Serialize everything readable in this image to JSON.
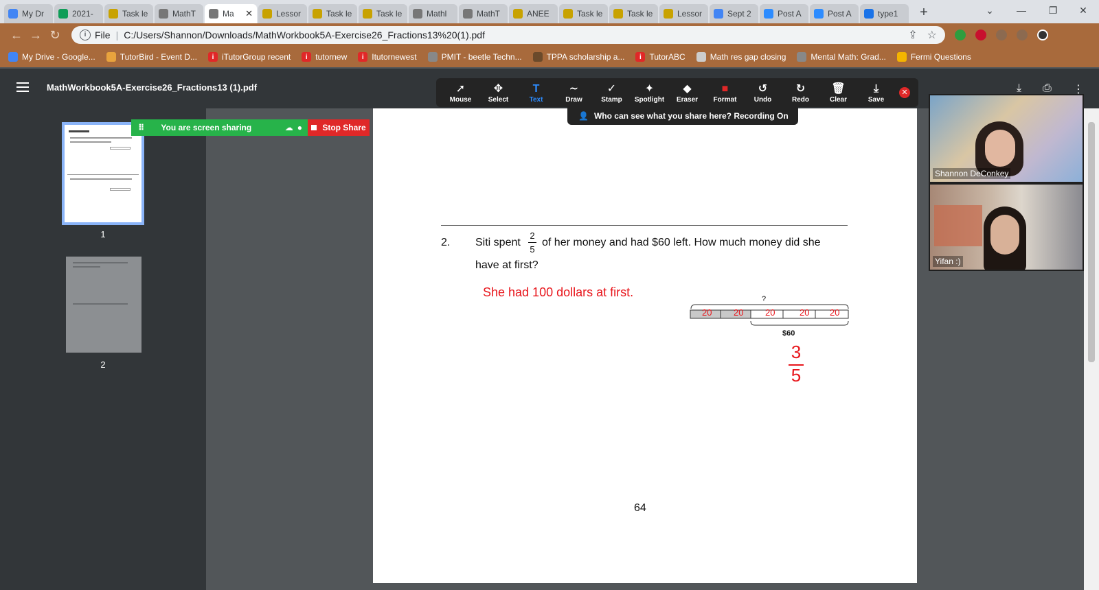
{
  "tabs": [
    {
      "title": "My Dr",
      "color": "#4285f4"
    },
    {
      "title": "2021-",
      "color": "#0f9d58"
    },
    {
      "title": "Task le",
      "color": "#c8a200"
    },
    {
      "title": "MathT",
      "color": "#777777"
    },
    {
      "title": "Ma",
      "color": "#777777",
      "active": true
    },
    {
      "title": "Lessor",
      "color": "#c8a200"
    },
    {
      "title": "Task le",
      "color": "#c8a200"
    },
    {
      "title": "Task le",
      "color": "#c8a200"
    },
    {
      "title": "Mathl",
      "color": "#777777"
    },
    {
      "title": "MathT",
      "color": "#777777"
    },
    {
      "title": "ANEE",
      "color": "#c8a200"
    },
    {
      "title": "Task le",
      "color": "#c8a200"
    },
    {
      "title": "Task le",
      "color": "#c8a200"
    },
    {
      "title": "Lessor",
      "color": "#c8a200"
    },
    {
      "title": "Sept 2",
      "color": "#4285f4"
    },
    {
      "title": "Post A",
      "color": "#2d8cff"
    },
    {
      "title": "Post A",
      "color": "#2d8cff"
    },
    {
      "title": "type1",
      "color": "#1a73e8"
    }
  ],
  "browser": {
    "file_label": "File",
    "url": "C:/Users/Shannon/Downloads/MathWorkbook5A-Exercise26_Fractions13%20(1).pdf"
  },
  "bookmarks": [
    {
      "label": "My Drive - Google...",
      "color": "#4285f4"
    },
    {
      "label": "TutorBird - Event D...",
      "color": "#e8a33d"
    },
    {
      "label": "iTutorGroup recent",
      "color": "#e02828",
      "glyph": "i"
    },
    {
      "label": "tutornew",
      "color": "#e02828",
      "glyph": "i"
    },
    {
      "label": "Itutornewest",
      "color": "#e02828",
      "glyph": "i"
    },
    {
      "label": "PMIT - beetle Techn...",
      "color": "#888888"
    },
    {
      "label": "TPPA scholarship a...",
      "color": "#6b4a2b"
    },
    {
      "label": "TutorABC",
      "color": "#e02828",
      "glyph": "i"
    },
    {
      "label": "Math res gap closing",
      "color": "#cccccc"
    },
    {
      "label": "Mental Math: Grad...",
      "color": "#888888"
    },
    {
      "label": "Fermi Questions",
      "color": "#f4b400"
    }
  ],
  "pdf": {
    "title": "MathWorkbook5A-Exercise26_Fractions13 (1).pdf",
    "thumbnails": [
      {
        "label": "1"
      },
      {
        "label": "2"
      }
    ],
    "question_number": "2.",
    "question_part1": "Siti spent",
    "fraction_num": "2",
    "fraction_den": "5",
    "question_part2": "of her money and had $60 left. How much money did she",
    "question_line2": "have at first?",
    "answer": "She had 100 dollars at first.",
    "question_mark": "?",
    "bar_segments": [
      "20",
      "20",
      "20",
      "20",
      "20"
    ],
    "bar_label": "$60",
    "handwritten_num": "3",
    "handwritten_den": "5",
    "page_number": "64"
  },
  "annotation_tools": [
    {
      "label": "Mouse",
      "icon": "mouse-pointer-icon",
      "glyph": "➚"
    },
    {
      "label": "Select",
      "icon": "move-icon",
      "glyph": "✥"
    },
    {
      "label": "Text",
      "icon": "text-icon",
      "glyph": "T",
      "selected": true
    },
    {
      "label": "Draw",
      "icon": "squiggle-icon",
      "glyph": "∼"
    },
    {
      "label": "Stamp",
      "icon": "checkmark-icon",
      "glyph": "✓"
    },
    {
      "label": "Spotlight",
      "icon": "spotlight-icon",
      "glyph": "✦"
    },
    {
      "label": "Eraser",
      "icon": "eraser-icon",
      "glyph": "◆"
    },
    {
      "label": "Format",
      "icon": "format-color-icon",
      "glyph": "■"
    },
    {
      "label": "Undo",
      "icon": "undo-icon",
      "glyph": "↺"
    },
    {
      "label": "Redo",
      "icon": "redo-icon",
      "glyph": "↻"
    },
    {
      "label": "Clear",
      "icon": "trash-icon",
      "glyph": "🗑"
    },
    {
      "label": "Save",
      "icon": "save-download-icon",
      "glyph": "⤓"
    }
  ],
  "recording_notice": "Who can see what you share here? Recording On",
  "share_bar": {
    "status": "You are screen sharing",
    "stop_label": "Stop Share"
  },
  "videos": [
    {
      "name": "Shannon DeConkey"
    },
    {
      "name": "Yifan :)"
    }
  ],
  "colors": {
    "accent_blue": "#2d8cff",
    "share_green": "#27b34a",
    "stop_red": "#e02828",
    "annotation_red": "#e8151b"
  }
}
